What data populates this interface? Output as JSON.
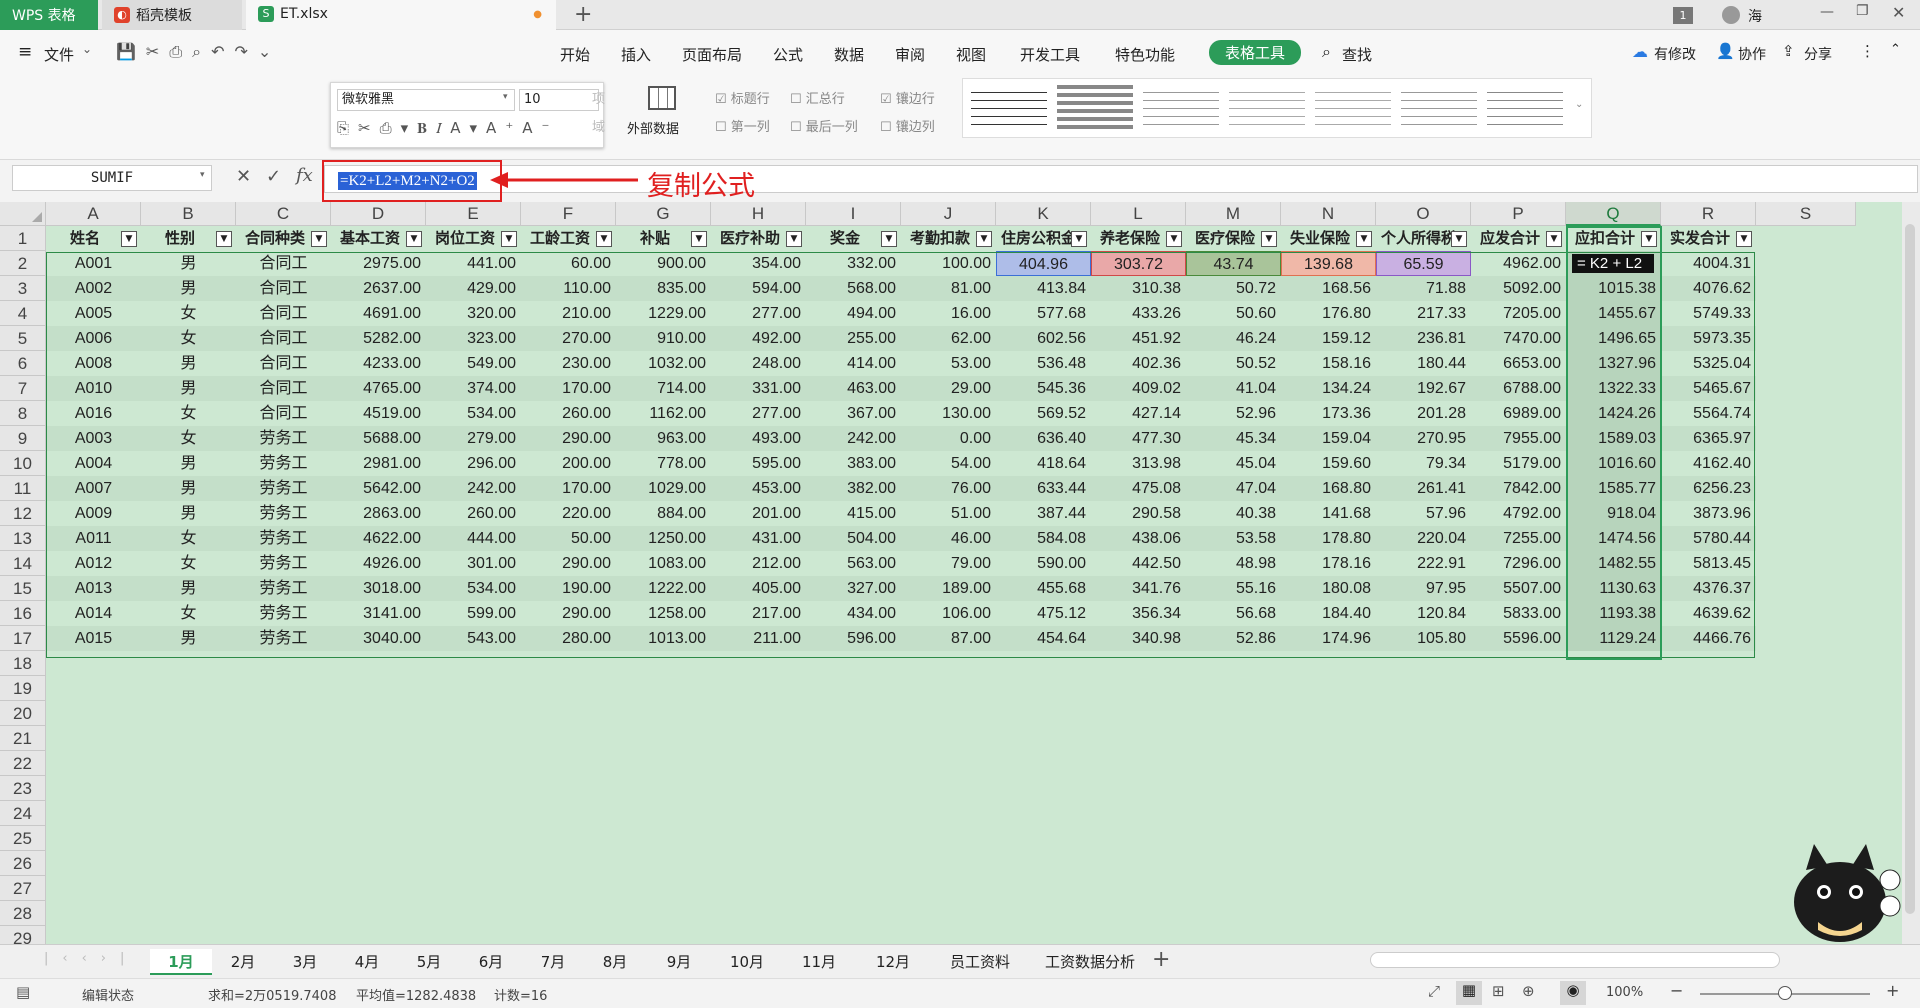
{
  "tabs": {
    "wps": "WPS 表格",
    "template": "稻壳模板",
    "file": "ET.xlsx",
    "user": "海",
    "badge": "1"
  },
  "menu": {
    "file": "文件",
    "items": [
      "开始",
      "插入",
      "页面布局",
      "公式",
      "数据",
      "审阅",
      "视图",
      "开发工具",
      "特色功能"
    ],
    "active": "表格工具",
    "search": "查找",
    "modified": "有修改",
    "collab": "协作",
    "share": "分享"
  },
  "ribbon": {
    "font": "微软雅黑",
    "size": "10",
    "external_data": "外部数据",
    "opt1": "标题行",
    "opt2": "汇总行",
    "opt3": "镶边行",
    "opt4": "第一列",
    "opt5": "最后一列",
    "opt6": "镶边列",
    "ghost1": "项",
    "ghost2": "域"
  },
  "formula_bar": {
    "name_box": "SUMIF",
    "fx": "fx",
    "formula": "=K2+L2+M2+N2+O2",
    "annotation": "复制公式"
  },
  "columns": [
    "A",
    "B",
    "C",
    "D",
    "E",
    "F",
    "G",
    "H",
    "I",
    "J",
    "K",
    "L",
    "M",
    "N",
    "O",
    "P",
    "Q",
    "R",
    "S"
  ],
  "headers": [
    "姓名",
    "性别",
    "合同种类",
    "基本工资",
    "岗位工资",
    "工龄工资",
    "补贴",
    "医疗补助",
    "奖金",
    "考勤扣款",
    "住房公积金",
    "养老保险",
    "医疗保险",
    "失业保险",
    "个人所得税",
    "应发合计",
    "应扣合计",
    "实发合计"
  ],
  "edit_cell": "= K2 + L2",
  "rows": [
    [
      "A001",
      "男",
      "合同工",
      "2975.00",
      "441.00",
      "60.00",
      "900.00",
      "354.00",
      "332.00",
      "100.00",
      "404.96",
      "303.72",
      "43.74",
      "139.68",
      "65.59",
      "4962.00",
      "",
      "4004.31"
    ],
    [
      "A002",
      "男",
      "合同工",
      "2637.00",
      "429.00",
      "110.00",
      "835.00",
      "594.00",
      "568.00",
      "81.00",
      "413.84",
      "310.38",
      "50.72",
      "168.56",
      "71.88",
      "5092.00",
      "1015.38",
      "4076.62"
    ],
    [
      "A005",
      "女",
      "合同工",
      "4691.00",
      "320.00",
      "210.00",
      "1229.00",
      "277.00",
      "494.00",
      "16.00",
      "577.68",
      "433.26",
      "50.60",
      "176.80",
      "217.33",
      "7205.00",
      "1455.67",
      "5749.33"
    ],
    [
      "A006",
      "女",
      "合同工",
      "5282.00",
      "323.00",
      "270.00",
      "910.00",
      "492.00",
      "255.00",
      "62.00",
      "602.56",
      "451.92",
      "46.24",
      "159.12",
      "236.81",
      "7470.00",
      "1496.65",
      "5973.35"
    ],
    [
      "A008",
      "男",
      "合同工",
      "4233.00",
      "549.00",
      "230.00",
      "1032.00",
      "248.00",
      "414.00",
      "53.00",
      "536.48",
      "402.36",
      "50.52",
      "158.16",
      "180.44",
      "6653.00",
      "1327.96",
      "5325.04"
    ],
    [
      "A010",
      "男",
      "合同工",
      "4765.00",
      "374.00",
      "170.00",
      "714.00",
      "331.00",
      "463.00",
      "29.00",
      "545.36",
      "409.02",
      "41.04",
      "134.24",
      "192.67",
      "6788.00",
      "1322.33",
      "5465.67"
    ],
    [
      "A016",
      "女",
      "合同工",
      "4519.00",
      "534.00",
      "260.00",
      "1162.00",
      "277.00",
      "367.00",
      "130.00",
      "569.52",
      "427.14",
      "52.96",
      "173.36",
      "201.28",
      "6989.00",
      "1424.26",
      "5564.74"
    ],
    [
      "A003",
      "女",
      "劳务工",
      "5688.00",
      "279.00",
      "290.00",
      "963.00",
      "493.00",
      "242.00",
      "0.00",
      "636.40",
      "477.30",
      "45.34",
      "159.04",
      "270.95",
      "7955.00",
      "1589.03",
      "6365.97"
    ],
    [
      "A004",
      "男",
      "劳务工",
      "2981.00",
      "296.00",
      "200.00",
      "778.00",
      "595.00",
      "383.00",
      "54.00",
      "418.64",
      "313.98",
      "45.04",
      "159.60",
      "79.34",
      "5179.00",
      "1016.60",
      "4162.40"
    ],
    [
      "A007",
      "男",
      "劳务工",
      "5642.00",
      "242.00",
      "170.00",
      "1029.00",
      "453.00",
      "382.00",
      "76.00",
      "633.44",
      "475.08",
      "47.04",
      "168.80",
      "261.41",
      "7842.00",
      "1585.77",
      "6256.23"
    ],
    [
      "A009",
      "男",
      "劳务工",
      "2863.00",
      "260.00",
      "220.00",
      "884.00",
      "201.00",
      "415.00",
      "51.00",
      "387.44",
      "290.58",
      "40.38",
      "141.68",
      "57.96",
      "4792.00",
      "918.04",
      "3873.96"
    ],
    [
      "A011",
      "女",
      "劳务工",
      "4622.00",
      "444.00",
      "50.00",
      "1250.00",
      "431.00",
      "504.00",
      "46.00",
      "584.08",
      "438.06",
      "53.58",
      "178.80",
      "220.04",
      "7255.00",
      "1474.56",
      "5780.44"
    ],
    [
      "A012",
      "女",
      "劳务工",
      "4926.00",
      "301.00",
      "290.00",
      "1083.00",
      "212.00",
      "563.00",
      "79.00",
      "590.00",
      "442.50",
      "48.98",
      "178.16",
      "222.91",
      "7296.00",
      "1482.55",
      "5813.45"
    ],
    [
      "A013",
      "男",
      "劳务工",
      "3018.00",
      "534.00",
      "190.00",
      "1222.00",
      "405.00",
      "327.00",
      "189.00",
      "455.68",
      "341.76",
      "55.16",
      "180.08",
      "97.95",
      "5507.00",
      "1130.63",
      "4376.37"
    ],
    [
      "A014",
      "女",
      "劳务工",
      "3141.00",
      "599.00",
      "290.00",
      "1258.00",
      "217.00",
      "434.00",
      "106.00",
      "475.12",
      "356.34",
      "56.68",
      "184.40",
      "120.84",
      "5833.00",
      "1193.38",
      "4639.62"
    ],
    [
      "A015",
      "男",
      "劳务工",
      "3040.00",
      "543.00",
      "280.00",
      "1013.00",
      "211.00",
      "596.00",
      "87.00",
      "454.64",
      "340.98",
      "52.86",
      "174.96",
      "105.80",
      "5596.00",
      "1129.24",
      "4466.76"
    ]
  ],
  "row_numbers": [
    "1",
    "2",
    "3",
    "4",
    "5",
    "6",
    "7",
    "8",
    "9",
    "10",
    "11",
    "12",
    "13",
    "14",
    "15",
    "16",
    "17",
    "18",
    "19",
    "20",
    "21",
    "22",
    "23",
    "24",
    "25",
    "26",
    "27",
    "28",
    "29"
  ],
  "sheet_tabs": [
    "1月",
    "2月",
    "3月",
    "4月",
    "5月",
    "6月",
    "7月",
    "8月",
    "9月",
    "10月",
    "11月",
    "12月",
    "员工资料",
    "工资数据分析"
  ],
  "active_sheet": "1月",
  "status": {
    "mode": "编辑状态",
    "sum": "求和=2万0519.7408",
    "avg": "平均值=1282.4838",
    "count": "计数=16",
    "zoom": "100%"
  },
  "colors": {
    "accent": "#2c9c59",
    "annotation": "#e02020",
    "grid_bg": "#cde8d2"
  }
}
